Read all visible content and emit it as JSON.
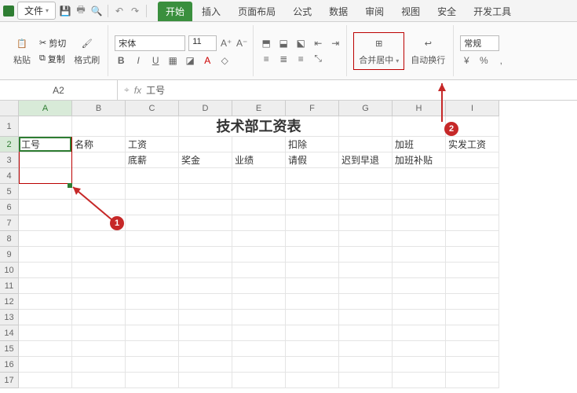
{
  "titlebar": {
    "file_label": "文件"
  },
  "tabs": {
    "items": [
      {
        "label": "开始"
      },
      {
        "label": "插入"
      },
      {
        "label": "页面布局"
      },
      {
        "label": "公式"
      },
      {
        "label": "数据"
      },
      {
        "label": "审阅"
      },
      {
        "label": "视图"
      },
      {
        "label": "安全"
      },
      {
        "label": "开发工具"
      }
    ]
  },
  "ribbon": {
    "clipboard": {
      "cut": "剪切",
      "copy": "复制",
      "paste": "粘贴",
      "format_painter": "格式刷"
    },
    "font": {
      "name": "宋体",
      "size": "11"
    },
    "merge": {
      "label": "合并居中"
    },
    "wrap": {
      "label": "自动换行"
    },
    "number_format": {
      "label": "常规"
    }
  },
  "namebox": {
    "value": "A2"
  },
  "formula": {
    "value": "工号"
  },
  "sheet": {
    "columns": [
      "A",
      "B",
      "C",
      "D",
      "E",
      "F",
      "G",
      "H",
      "I"
    ],
    "rows": [
      "1",
      "2",
      "3",
      "4",
      "5",
      "6",
      "7",
      "8",
      "9",
      "10",
      "11",
      "12",
      "13",
      "14",
      "15",
      "16",
      "17"
    ],
    "title": "技术部工资表",
    "headers_row2": [
      "工号",
      "名称",
      "工资",
      "",
      "",
      "扣除",
      "",
      "加班",
      "实发工资"
    ],
    "headers_row3": [
      "",
      "",
      "底薪",
      "奖金",
      "业绩",
      "请假",
      "迟到早退",
      "加班补贴",
      ""
    ]
  },
  "annot": {
    "n1": "1",
    "n2": "2"
  }
}
